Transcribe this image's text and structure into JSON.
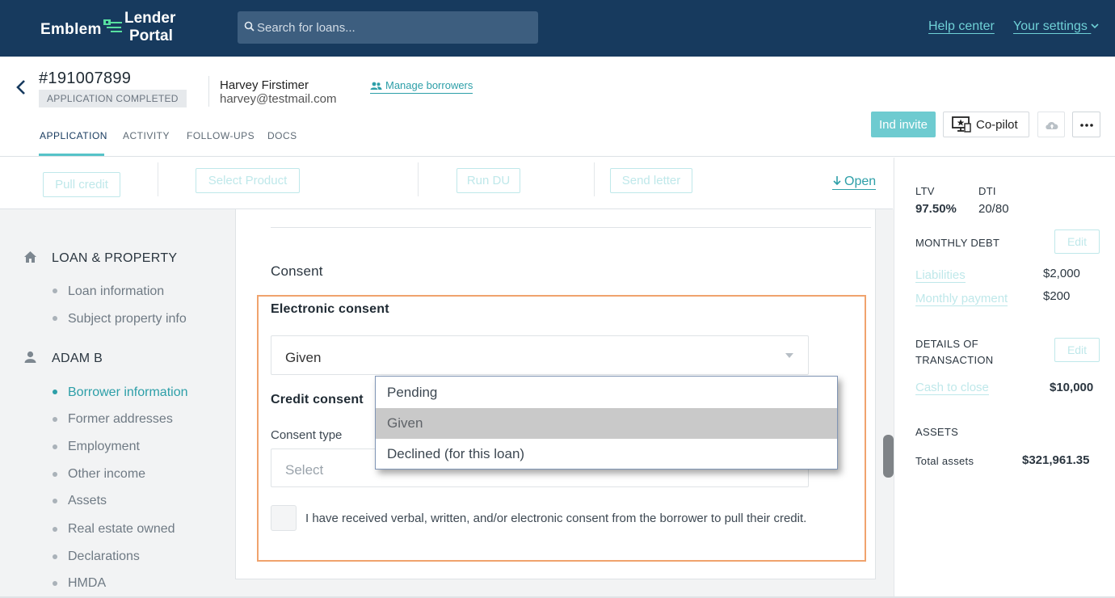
{
  "brand": {
    "name_left": "Emblem",
    "name_right_line1": "Lender",
    "name_right_line2": "Portal"
  },
  "search": {
    "placeholder": "Search for loans..."
  },
  "top_links": {
    "help": "Help center",
    "settings": "Your settings"
  },
  "header": {
    "loan_id": "#191007899",
    "status": "APPLICATION COMPLETED",
    "borrower_name": "Harvey Firstimer",
    "borrower_email": "harvey@testmail.com",
    "manage_label": "Manage borrowers",
    "tabs": [
      "APPLICATION",
      "ACTIVITY",
      "FOLLOW-UPS",
      "DOCS"
    ],
    "ind_invite": "Ind invite",
    "copilot": "Co-pilot"
  },
  "actions": {
    "pull_credit": "Pull credit",
    "select_product": "Select Product",
    "run_du": "Run DU",
    "send_letter": "Send letter",
    "open": "Open"
  },
  "sidebar": {
    "section1": "LOAN & PROPERTY",
    "section1_items": [
      "Loan information",
      "Subject property info"
    ],
    "section2": "ADAM B",
    "section2_items": [
      "Borrower information",
      "Former addresses",
      "Employment",
      "Other income",
      "Assets",
      "Real estate owned",
      "Declarations",
      "HMDA"
    ]
  },
  "form": {
    "section_title": "Consent",
    "electronic_label": "Electronic consent",
    "electronic_value": "Given",
    "credit_label": "Credit consent",
    "consent_type_label": "Consent type",
    "consent_type_placeholder": "Select",
    "checkbox_text": "I have received verbal, written, and/or electronic consent from the borrower to pull their credit.",
    "dropdown_options": [
      "Pending",
      "Given",
      "Declined (for this loan)"
    ]
  },
  "right_panel": {
    "ltv_label": "LTV",
    "ltv_value": "97.50%",
    "dti_label": "DTI",
    "dti_value": "20/80",
    "monthly_debt_label": "MONTHLY DEBT",
    "edit": "Edit",
    "liabilities_label": "Liabilities",
    "liabilities_value": "$2,000",
    "monthly_payment_label": "Monthly payment",
    "monthly_payment_value": "$200",
    "details_label_1": "DETAILS OF",
    "details_label_2": "TRANSACTION",
    "cash_to_close_label": "Cash to close",
    "cash_to_close_value": "$10,000",
    "assets_label": "ASSETS",
    "total_assets_label": "Total assets",
    "total_assets_value": "$321,961.35"
  },
  "colors": {
    "nav": "#173a5e",
    "accent": "#2d9fa8",
    "highlight": "#f0a36d"
  }
}
